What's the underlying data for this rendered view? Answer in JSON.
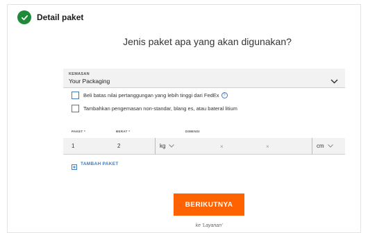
{
  "step": {
    "title": "Detail paket",
    "status_icon": "check-icon"
  },
  "question": "Jenis paket apa yang akan digunakan?",
  "packaging": {
    "label": "KEMASAN",
    "value": "Your Packaging",
    "icon": "chevron-down-icon"
  },
  "options": [
    {
      "label": "Beli batas nilai pertanggungan yang lebih tinggi dari FedEx",
      "checked": false,
      "has_info": true
    },
    {
      "label": "Tambahkan pengemasan non-standar, blang es, atau bateral litium",
      "checked": false,
      "has_info": false
    }
  ],
  "package_row": {
    "col_paket": "PAKET *",
    "col_berat": "BERAT *",
    "col_dimensi": "DIMENSI",
    "paket_value": "1",
    "berat_value": "2",
    "weight_unit": "kg",
    "dim_sep_1": "×",
    "dim_sep_2": "×",
    "dim_unit": "cm"
  },
  "add_package": {
    "label": "TAMBAH PAKET",
    "icon": "add-package-icon"
  },
  "next": {
    "label": "BERIKUTNYA",
    "caption": "ke 'Layanan'"
  },
  "colors": {
    "accent_orange": "#ff6200",
    "link_blue": "#3b7cc2",
    "success_green": "#1f8a3a"
  }
}
